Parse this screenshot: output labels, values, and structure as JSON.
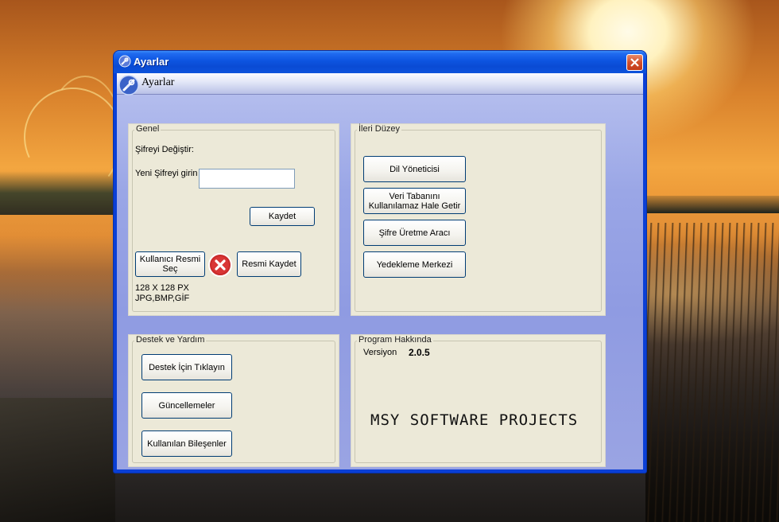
{
  "window": {
    "title": "Ayarlar",
    "header_title": "Ayarlar"
  },
  "genel": {
    "legend": "Genel",
    "change_password_label": "Şifreyi Değiştir:",
    "new_password_label": "Yeni Şifreyi girin",
    "new_password_value": "",
    "save_button": "Kaydet",
    "user_image_button": "Kullanıcı Resmi Seç",
    "save_image_button": "Resmi Kaydet",
    "image_size_note": "128 X 128 PX",
    "image_format_note": "JPG,BMP,GİF"
  },
  "ileri_duzey": {
    "legend": "İleri Düzey",
    "buttons": [
      "Dil Yöneticisi",
      "Veri Tabanını Kullanılamaz Hale Getir",
      "Şifre Üretme Aracı",
      "Yedekleme Merkezi"
    ]
  },
  "destek": {
    "legend": "Destek ve Yardım",
    "buttons": [
      "Destek İçin Tıklayın",
      "Güncellemeler",
      "Kullanılan Bileşenler"
    ]
  },
  "hakkinda": {
    "legend": "Program Hakkında",
    "version_label": "Versiyon",
    "version_value": "2.0.5",
    "brand": "MSY SOFTWARE PROJECTS"
  },
  "colors": {
    "titlebar": "#0a4bd4",
    "close_button": "#d2502c",
    "panel": "#ece9d8",
    "client_bg": "#9aa6e6"
  },
  "icons": {
    "title": "tools-icon",
    "header": "tools-icon",
    "close": "close-icon",
    "remove_image": "red-x-icon"
  }
}
